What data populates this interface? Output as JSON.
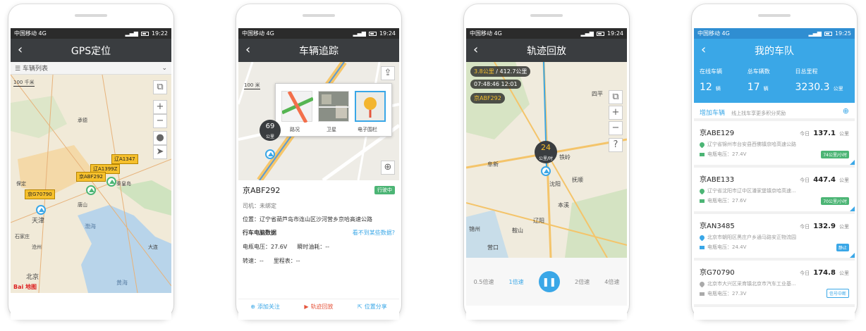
{
  "status": {
    "carrier": "中国移动 4G",
    "time1": "19:22",
    "time2": "19:24",
    "time3": "19:24",
    "time4": "19:25"
  },
  "screen1": {
    "title": "GPS定位",
    "selector": "车辆列表",
    "plates": [
      "辽A1347",
      "辽A1399Z",
      "京ABF292",
      "京G70790"
    ],
    "places": [
      "北京",
      "天津",
      "唐山",
      "秦皇岛",
      "沧州",
      "石家庄",
      "保定",
      "承德",
      "渤海",
      "黄海",
      "大连"
    ],
    "scale": "100 千米",
    "logo": "Bai 地图"
  },
  "screen2": {
    "title": "车辆追踪",
    "scale": "100 米",
    "layers": [
      "路况",
      "卫星",
      "电子围栏"
    ],
    "speed_badge": "69",
    "speed_unit": "公里",
    "plate": "京ABF292",
    "status_badge": "行驶中",
    "driver": "司机：未绑定",
    "location": "位置：辽宁省葫芦岛市连山区沙河营乡京哈高速公路",
    "data_heading": "行车电脑数据",
    "data_link": "看不到某些数据?",
    "voltage": "电瓶电压：27.6V",
    "fuel": "瞬时油耗：--",
    "rpm": "转速：--",
    "odometer": "里程表：--",
    "actions": [
      "添加关注",
      "轨迹回放",
      "位置分享"
    ]
  },
  "screen3": {
    "title": "轨迹回放",
    "distance": "3.8公里",
    "distance_total": "/ 412.7公里",
    "clock": "07:48:46 12:01",
    "plate": "京ABF292",
    "speed": "24",
    "speed_unit": "公里/时",
    "places": [
      "铁岭",
      "沈阳",
      "抚顺",
      "本溪",
      "辽阳",
      "鞍山",
      "阜新",
      "锦州",
      "营口",
      "四平"
    ],
    "speeds": [
      "0.5倍速",
      "1倍速",
      "2倍速",
      "4倍速"
    ]
  },
  "screen4": {
    "title": "我的车队",
    "stats": [
      {
        "label": "在线车辆",
        "value": "12",
        "unit": "辆"
      },
      {
        "label": "总车辆数",
        "value": "17",
        "unit": "辆"
      },
      {
        "label": "日总里程",
        "value": "3230.3",
        "unit": "公里"
      }
    ],
    "add_label": "增加车辆",
    "add_hint": "线上找车享更多积分奖励",
    "vehicles": [
      {
        "plate": "京ABE129",
        "today": "今日",
        "km": "137.1",
        "unit": "公里",
        "addr": "辽宁省锦州市台安县西佛镇京哈高速公路",
        "volt": "电瓶电压：27.4V",
        "speed": "74公里/小时"
      },
      {
        "plate": "京ABE133",
        "today": "今日",
        "km": "447.4",
        "unit": "公里",
        "addr": "辽宁省沈阳市辽中区潘家堡镇京哈高速...",
        "volt": "电瓶电压：27.6V",
        "speed": "70公里/小时"
      },
      {
        "plate": "京AN3485",
        "today": "今日",
        "km": "132.9",
        "unit": "公里",
        "addr": "北京市朝阳区黑庄户乡通马路安正物流园",
        "volt": "电瓶电压：24.4V",
        "speed": "静止"
      },
      {
        "plate": "京G70790",
        "today": "今日",
        "km": "174.8",
        "unit": "公里",
        "addr": "北京市大兴区采育镇北京市汽车工业基...",
        "volt": "电瓶电压：27.3V",
        "speed": "信号中断"
      }
    ]
  },
  "colors": {
    "accent": "#3aa7e7",
    "green": "#4cb575",
    "header": "#3a3d40",
    "plate": "#f6c02c"
  }
}
